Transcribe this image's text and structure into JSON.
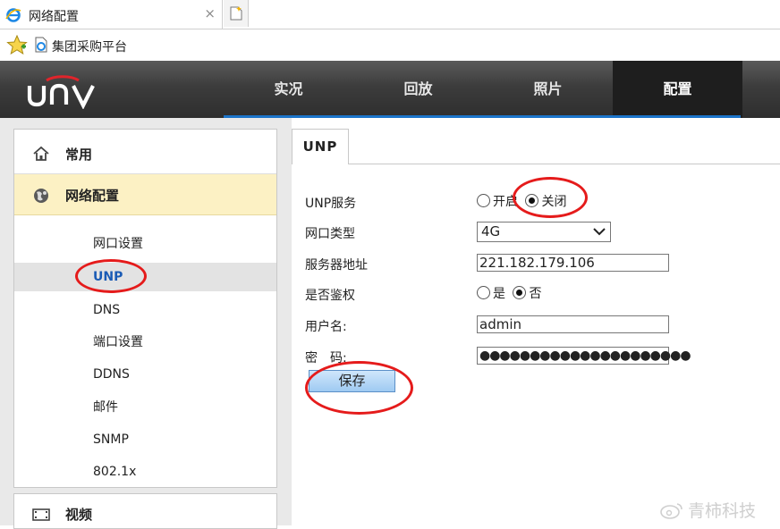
{
  "browser": {
    "tab_title": "网络配置",
    "close_glyph": "×",
    "favorites": [
      {
        "label": "集团采购平台"
      }
    ]
  },
  "app": {
    "logo_text": "UNV",
    "nav": [
      {
        "label": "实况"
      },
      {
        "label": "回放"
      },
      {
        "label": "照片"
      },
      {
        "label": "配置",
        "active": true
      }
    ],
    "accent_color": "#1b74c9"
  },
  "sidebar": {
    "sections": [
      {
        "label": "常用",
        "icon": "home-icon"
      },
      {
        "label": "网络配置",
        "icon": "network-globe-icon",
        "expanded": true
      },
      {
        "label": "视频",
        "icon": "video-icon"
      }
    ],
    "items": [
      {
        "label": "网口设置"
      },
      {
        "label": "UNP",
        "active": true
      },
      {
        "label": "DNS"
      },
      {
        "label": "端口设置"
      },
      {
        "label": "DDNS"
      },
      {
        "label": "邮件"
      },
      {
        "label": "SNMP"
      },
      {
        "label": "802.1x"
      }
    ]
  },
  "content": {
    "tab": "UNP",
    "form": {
      "unp_service": {
        "label": "UNP服务",
        "options": [
          "开启",
          "关闭"
        ],
        "selected": "关闭"
      },
      "port_type": {
        "label": "网口类型",
        "value": "4G"
      },
      "server_address": {
        "label": "服务器地址",
        "value": "221.182.179.106"
      },
      "auth": {
        "label": "是否鉴权",
        "options": [
          "是",
          "否"
        ],
        "selected": "否"
      },
      "username": {
        "label": "用户名:",
        "value": "admin"
      },
      "password": {
        "label": "密　码:",
        "value": "●●●●●●●●●●●●●●●●●●●●●"
      },
      "save_label": "保存"
    }
  },
  "annotation_color": "#e51b1b",
  "watermark": "青柿科技"
}
